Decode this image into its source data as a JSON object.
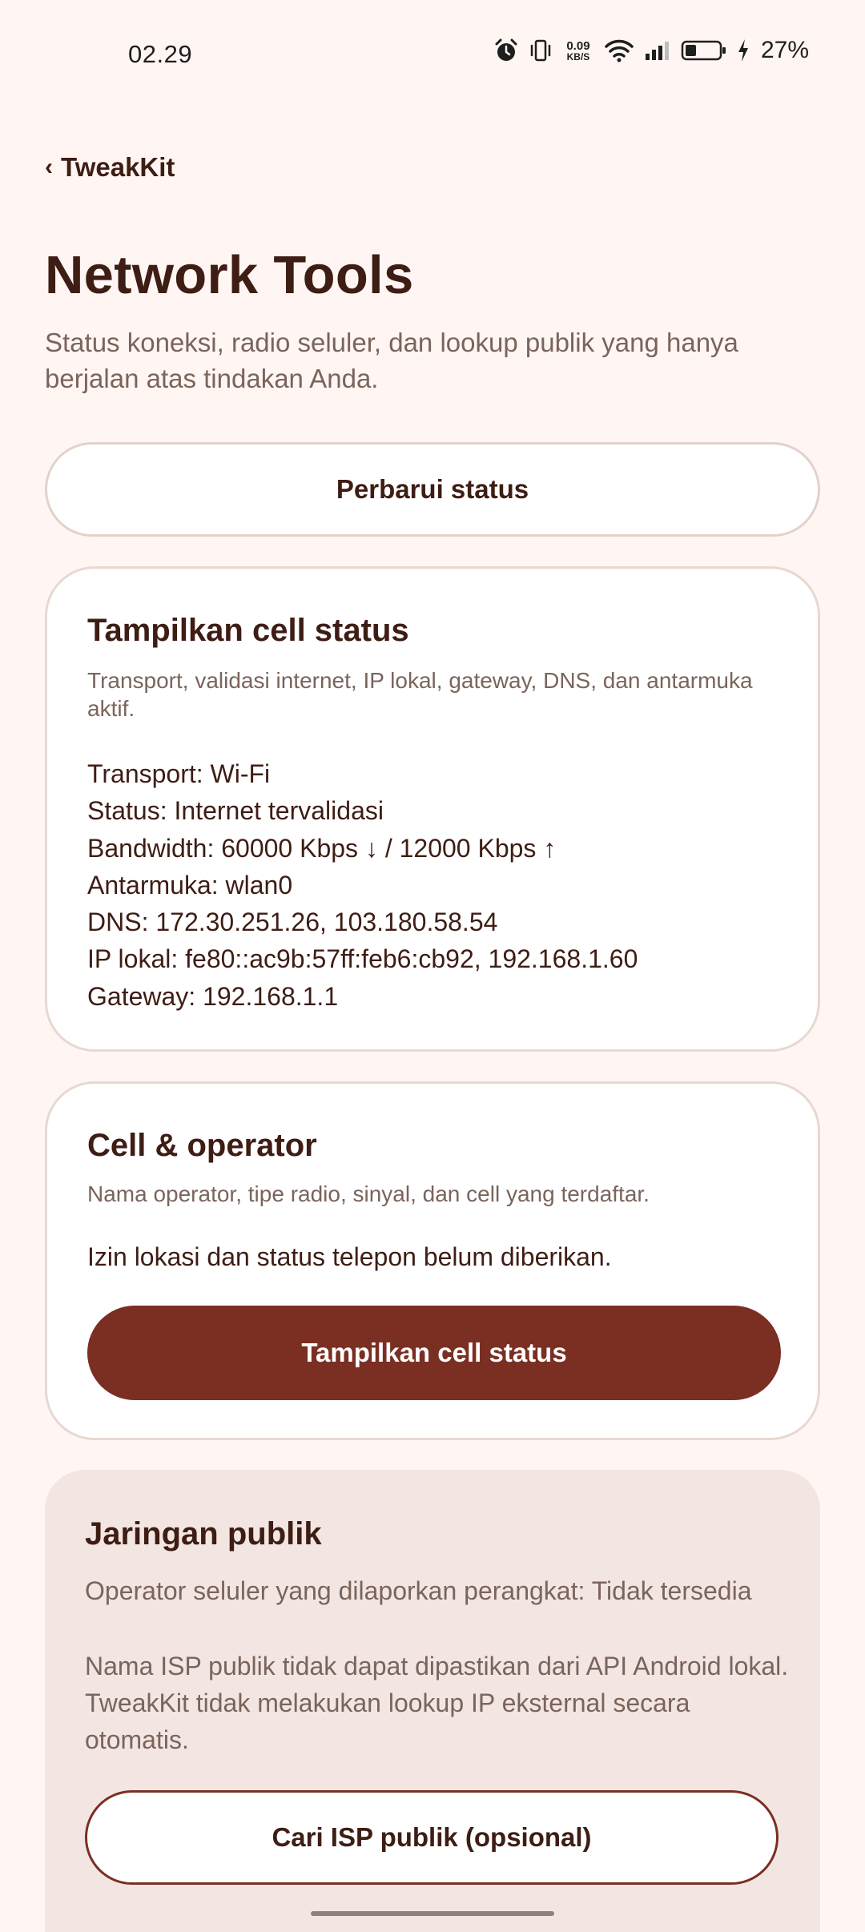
{
  "status_bar": {
    "time": "02.29",
    "net_speed_value": "0.09",
    "net_speed_unit": "KB/S",
    "battery_percent": "27%",
    "icons": [
      "alarm-icon",
      "vibrate-icon",
      "wifi-icon",
      "cell-signal-icon",
      "battery-icon",
      "charging-icon"
    ]
  },
  "header": {
    "back_label": "TweakKit",
    "back_chevron": "‹",
    "title": "Network Tools",
    "subtitle": "Status koneksi, radio seluler, dan lookup publik yang hanya berjalan atas tindakan Anda."
  },
  "refresh_button": {
    "label": "Perbarui status"
  },
  "connection_card": {
    "title": "Tampilkan cell status",
    "description": "Transport, validasi internet, IP lokal, gateway, DNS, dan antarmuka aktif.",
    "lines": [
      "Transport: Wi-Fi",
      "Status: Internet tervalidasi",
      "Bandwidth: 60000 Kbps ↓ / 12000 Kbps ↑",
      "Antarmuka: wlan0",
      "DNS: 172.30.251.26, 103.180.58.54",
      "IP lokal: fe80::ac9b:57ff:feb6:cb92, 192.168.1.60",
      "Gateway: 192.168.1.1"
    ]
  },
  "cell_card": {
    "title": "Cell & operator",
    "description": "Nama operator, tipe radio, sinyal, dan cell yang terdaftar.",
    "permission_text": "Izin lokasi dan status telepon belum diberikan.",
    "button_label": "Tampilkan cell status"
  },
  "public_card": {
    "title": "Jaringan publik",
    "operator_text": "Operator seluler yang dilaporkan perangkat: Tidak tersedia",
    "isp_text": "Nama ISP publik tidak dapat dipastikan dari API Android lokal. TweakKit tidak melakukan lookup IP eksternal secara otomatis.",
    "button_label": "Cari ISP publik (opsional)"
  },
  "colors": {
    "background": "#FFF6F3",
    "primary": "#7A2F22",
    "text": "#3E1D14",
    "muted_text": "#7A645C",
    "card_tint": "#F3E6E2"
  }
}
